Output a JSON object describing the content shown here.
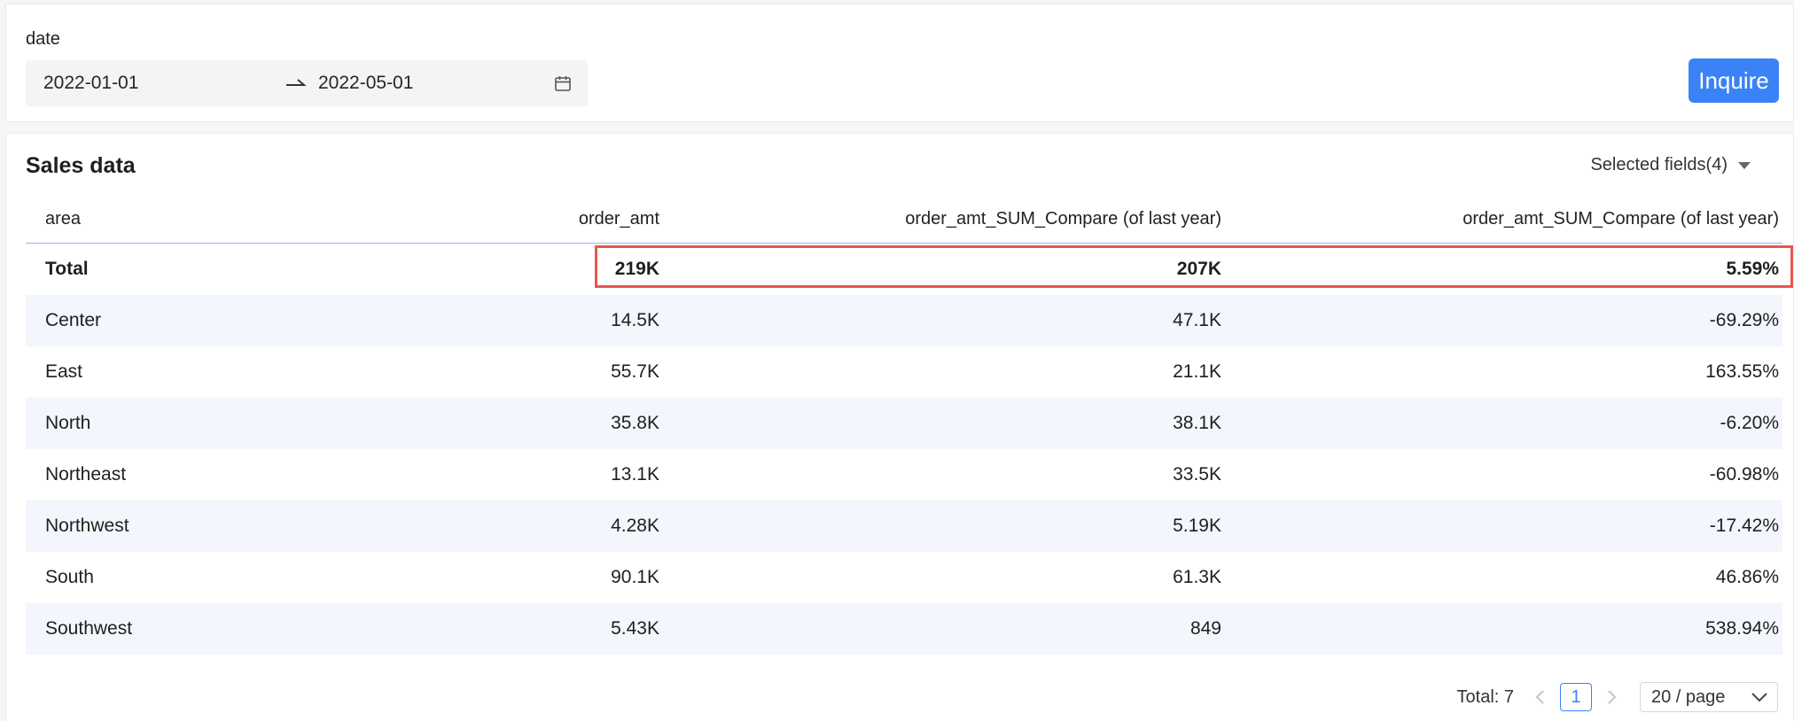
{
  "filter": {
    "label": "date",
    "start_date": "2022-01-01",
    "end_date": "2022-05-01",
    "inquire_label": "Inquire",
    "accent_color": "#3b82f6"
  },
  "panel": {
    "title": "Sales data",
    "fields_toggle": "Selected fields(4)"
  },
  "table": {
    "columns": [
      "area",
      "order_amt",
      "order_amt_SUM_Compare (of last year)",
      "order_amt_SUM_Compare (of last year)"
    ],
    "total": [
      "Total",
      "219K",
      "207K",
      "5.59%"
    ],
    "rows": [
      [
        "Center",
        "14.5K",
        "47.1K",
        "-69.29%"
      ],
      [
        "East",
        "55.7K",
        "21.1K",
        "163.55%"
      ],
      [
        "North",
        "35.8K",
        "38.1K",
        "-6.20%"
      ],
      [
        "Northeast",
        "13.1K",
        "33.5K",
        "-60.98%"
      ],
      [
        "Northwest",
        "4.28K",
        "5.19K",
        "-17.42%"
      ],
      [
        "South",
        "90.1K",
        "61.3K",
        "46.86%"
      ],
      [
        "Southwest",
        "5.43K",
        "849",
        "538.94%"
      ]
    ],
    "highlight_color": "#e8564e"
  },
  "pagination": {
    "total_label": "Total: 7",
    "current_page": "1",
    "page_size": "20 / page"
  },
  "icons": {
    "range_arrow": "arrow-right-icon",
    "calendar": "calendar-icon",
    "caret": "caret-down-icon",
    "prev": "chevron-left-icon",
    "next": "chevron-right-icon",
    "dropdown": "chevron-down-icon"
  }
}
